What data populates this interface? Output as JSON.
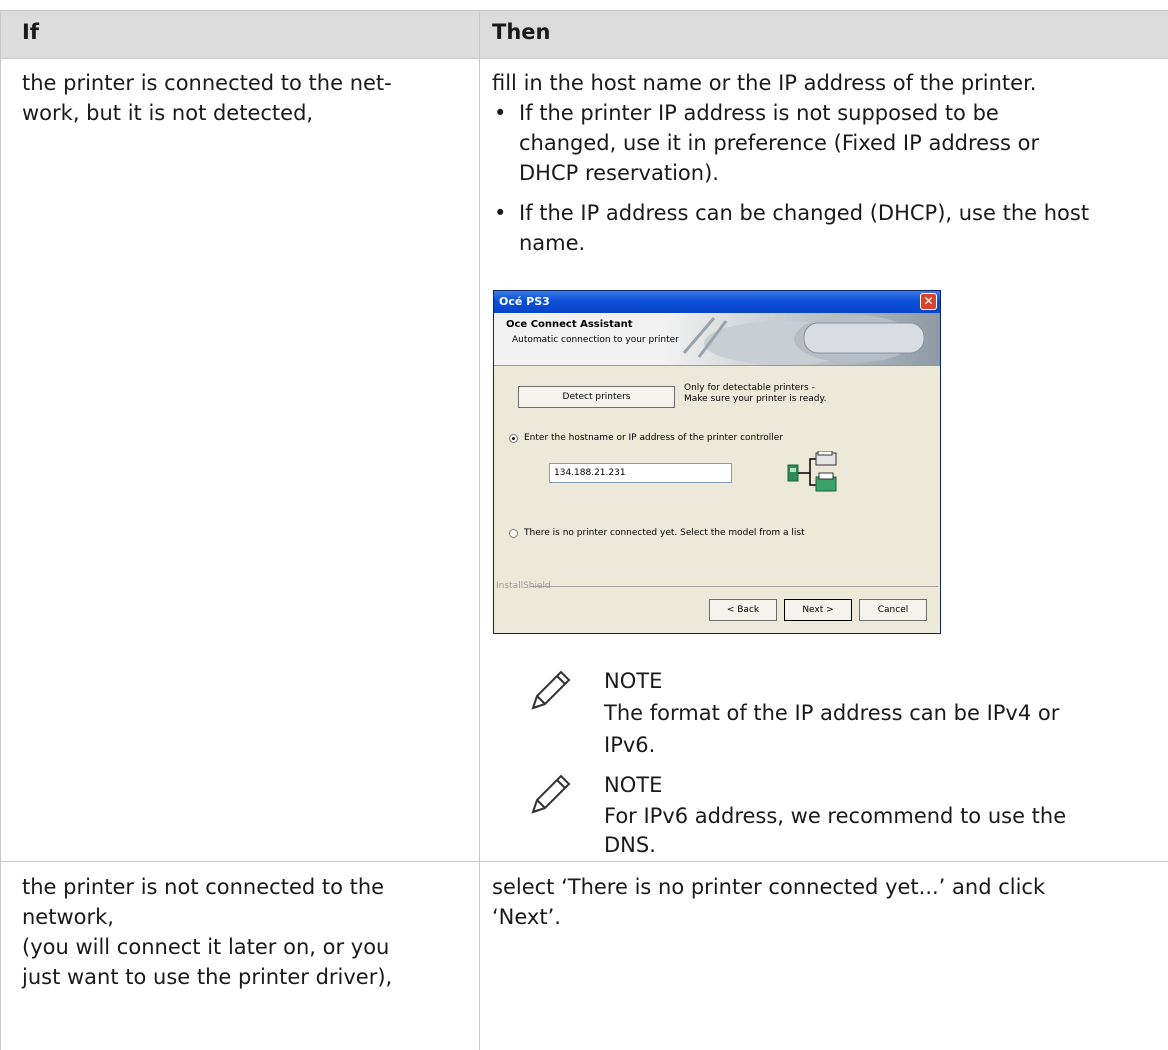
{
  "table": {
    "headers": [
      "If",
      "Then"
    ],
    "rows": [
      {
        "if_lines": [
          "the printer is connected to the net-",
          "work, but it is not detected,"
        ],
        "then_intro": "fill in the host name or the IP address of the printer.",
        "bullets": [
          [
            "If the printer IP address is not supposed to be",
            "changed, use it in preference (Fixed IP address or",
            "DHCP reservation)."
          ],
          [
            "If the IP address can be changed (DHCP), use the host",
            "name."
          ]
        ],
        "notes": [
          {
            "label": "NOTE",
            "lines": [
              "The format of the IP address can be IPv4 or",
              "IPv6."
            ]
          },
          {
            "label": "NOTE",
            "lines": [
              "For IPv6 address, we recommend to use the",
              "DNS."
            ]
          }
        ]
      },
      {
        "if_lines": [
          "the printer is not connected to the",
          "network,",
          "(you will connect it later on, or you",
          "just want to use the printer driver),"
        ],
        "then_lines": [
          "select ‘There is no printer connected yet...’ and click",
          "‘Next’."
        ]
      }
    ]
  },
  "dialog": {
    "title": "Océ PS3",
    "banner_title": "Oce Connect Assistant",
    "banner_subtitle": "Automatic connection to your printer",
    "detect_button": "Detect printers",
    "detect_hint_1": "Only for detectable printers -",
    "detect_hint_2": "Make sure your printer is ready.",
    "radio_hostname": "Enter the hostname or IP address of the printer controller",
    "ip_value": "134.188.21.231",
    "radio_no_printer": "There is no printer connected yet. Select the model from a list",
    "group_label": "InstallShield",
    "back_button": "< Back",
    "next_button": "Next >",
    "cancel_button": "Cancel"
  }
}
